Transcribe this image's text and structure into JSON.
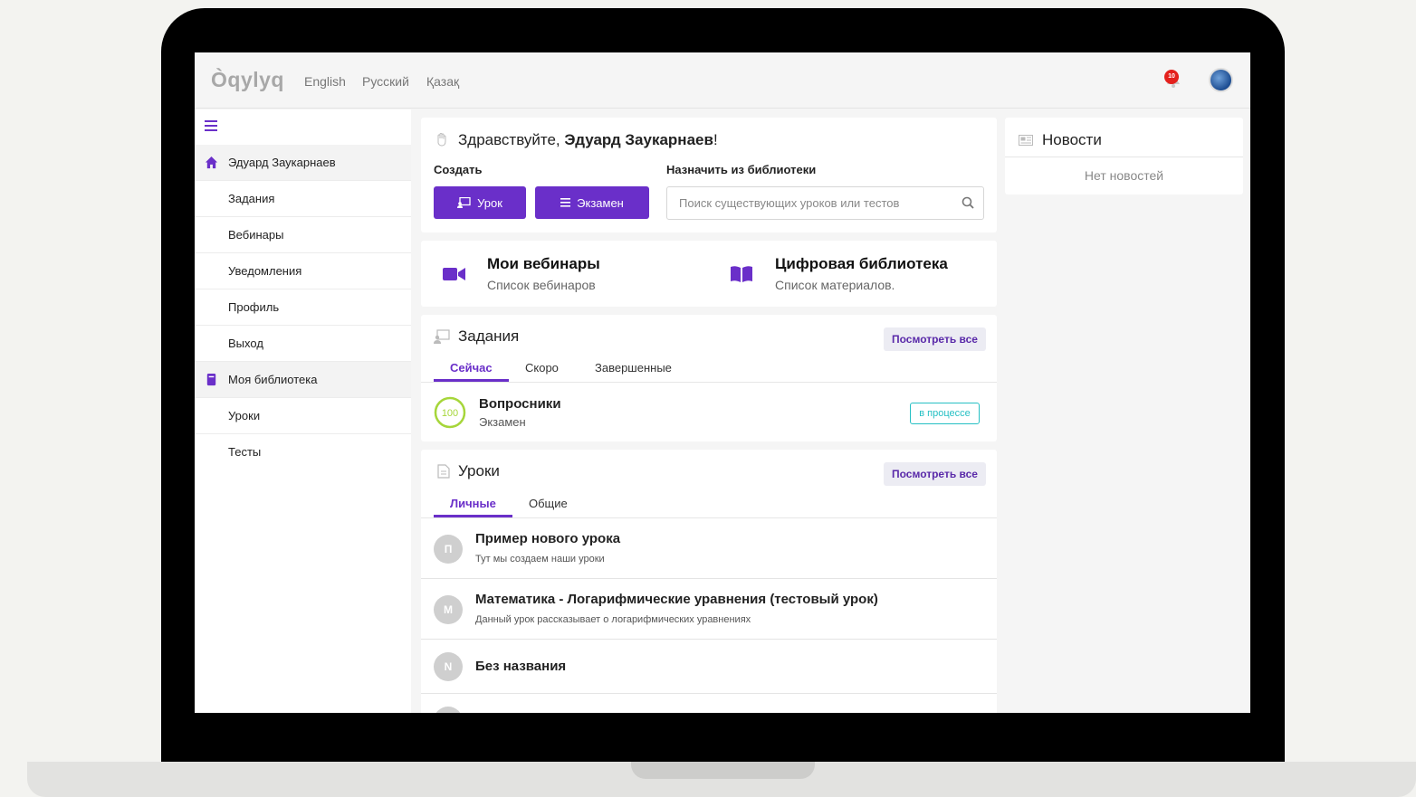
{
  "app": {
    "logo": "Òqylyq",
    "languages": [
      "English",
      "Русский",
      "Қазақ"
    ],
    "notifications_count": "10"
  },
  "sidebar": {
    "items": [
      {
        "label": "Эдуард Заукарнаев",
        "icon": "home-icon"
      },
      {
        "label": "Задания"
      },
      {
        "label": "Вебинары"
      },
      {
        "label": "Уведомления"
      },
      {
        "label": "Профиль"
      },
      {
        "label": "Выход"
      },
      {
        "label": "Моя библиотека",
        "icon": "book-icon"
      },
      {
        "label": "Уроки"
      },
      {
        "label": "Тесты"
      }
    ]
  },
  "greeting": {
    "prefix": "Здравствуйте, ",
    "name": "Эдуард Заукарнаев",
    "suffix": "!",
    "create_label": "Создать",
    "assign_label": "Назначить из библиотеки",
    "lesson_button": "Урок",
    "exam_button": "Экзамен",
    "search_placeholder": "Поиск существующих уроков или тестов"
  },
  "quick_links": {
    "webinars": {
      "title": "Мои вебинары",
      "subtitle": "Список вебинаров"
    },
    "library": {
      "title": "Цифровая библиотека",
      "subtitle": "Список материалов."
    }
  },
  "tasks": {
    "title": "Задания",
    "see_all": "Посмотреть все",
    "tabs": [
      "Сейчас",
      "Скоро",
      "Завершенные"
    ],
    "active_tab": "Сейчас",
    "items": [
      {
        "title": "Вопросники",
        "subtitle": "Экзамен",
        "progress": "100",
        "status": "в процессе"
      }
    ]
  },
  "lessons": {
    "title": "Уроки",
    "see_all": "Посмотреть все",
    "tabs": [
      "Личные",
      "Общие"
    ],
    "active_tab": "Личные",
    "items": [
      {
        "initial": "П",
        "title": "Пример нового урока",
        "subtitle": "Тут мы создаем наши уроки"
      },
      {
        "initial": "М",
        "title": "Математика - Логарифмические уравнения (тестовый урок)",
        "subtitle": "Данный урок рассказывает о логарифмических уравнениях"
      },
      {
        "initial": "N",
        "title": "Без названия",
        "subtitle": ""
      }
    ]
  },
  "news": {
    "title": "Новости",
    "empty": "Нет новостей"
  },
  "colors": {
    "accent": "#6a2fc9",
    "status": "#26c0c4",
    "progress": "#a6d63a",
    "badge": "#e4211d"
  }
}
